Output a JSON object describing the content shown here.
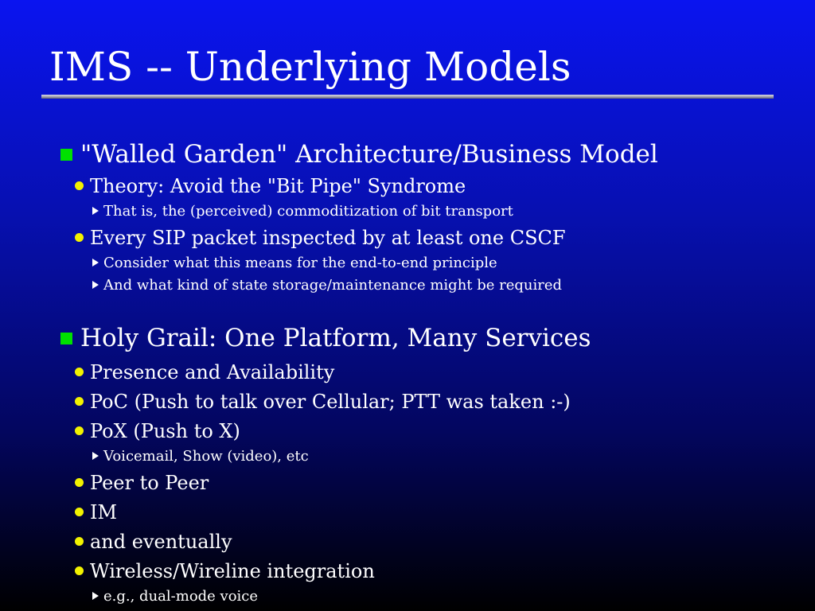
{
  "slide": {
    "title": "IMS -- Underlying Models",
    "bullets": [
      {
        "level": 1,
        "text": "\"Walled Garden\" Architecture/Business Model"
      },
      {
        "level": 2,
        "text": "Theory: Avoid the \"Bit Pipe\" Syndrome"
      },
      {
        "level": 3,
        "text": "That is, the (perceived) commoditization of bit transport"
      },
      {
        "level": 2,
        "text": "Every SIP packet inspected by at least one CSCF"
      },
      {
        "level": 3,
        "text": "Consider what this means for the end-to-end principle"
      },
      {
        "level": 3,
        "text": "And what kind of state storage/maintenance might be required"
      },
      {
        "level": 1,
        "text": "Holy Grail: One Platform, Many Services"
      },
      {
        "level": 2,
        "text": "Presence and Availability"
      },
      {
        "level": 2,
        "text": "PoC (Push to talk over Cellular; PTT was taken :-)"
      },
      {
        "level": 2,
        "text": "PoX (Push to X)"
      },
      {
        "level": 3,
        "text": "Voicemail, Show (video), etc"
      },
      {
        "level": 2,
        "text": "Peer to Peer"
      },
      {
        "level": 2,
        "text": "IM"
      },
      {
        "level": 2,
        "text": "and eventually"
      },
      {
        "level": 2,
        "text": "Wireless/Wireline integration"
      },
      {
        "level": 3,
        "text": "e.g., dual-mode voice"
      }
    ]
  },
  "colors": {
    "background_top": "#0a14f0",
    "background_bottom": "#000000",
    "level1_bullet": "#00e000",
    "level2_bullet": "#f2f200",
    "level3_bullet": "#ffffff",
    "text": "#ffffff"
  },
  "icons": {
    "level1": "green-square-bullet-icon",
    "level2": "yellow-dot-bullet-icon",
    "level3": "white-triangle-bullet-icon"
  }
}
